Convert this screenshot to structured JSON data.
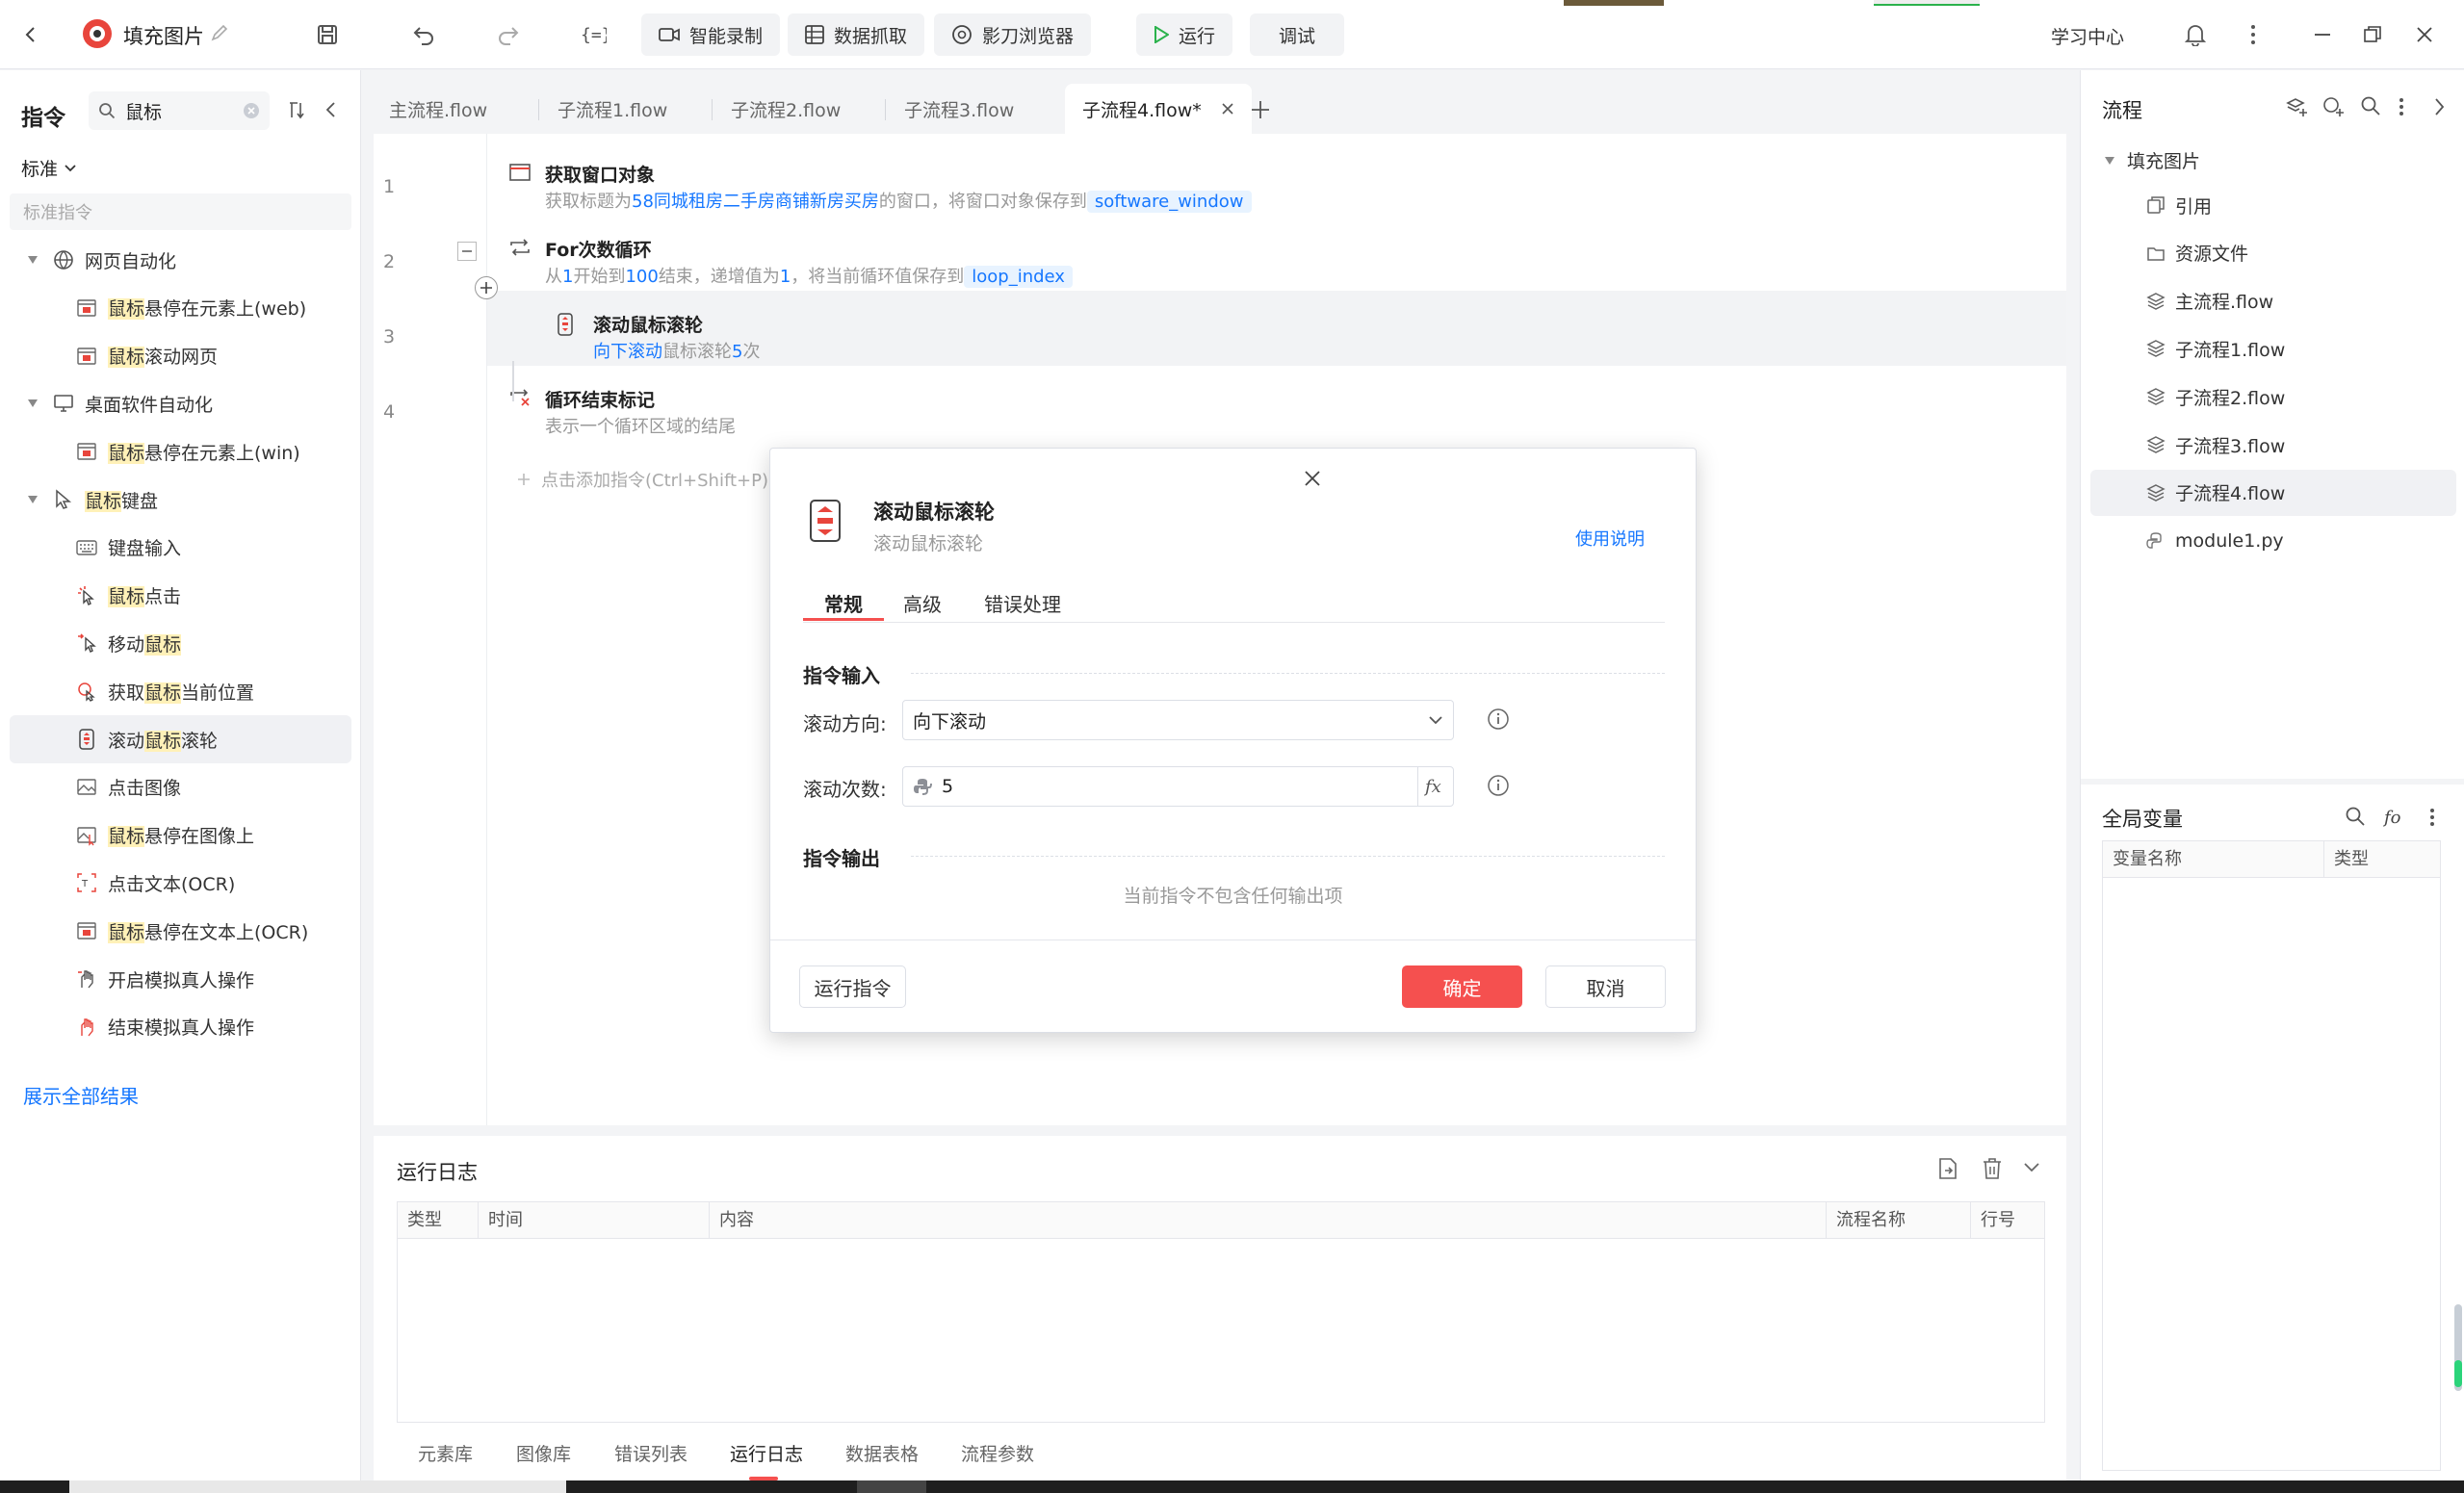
{
  "app": {
    "project_title": "填充图片",
    "toolbar": {
      "smart_record": "智能录制",
      "data_capture": "数据抓取",
      "browser": "影刀浏览器",
      "run": "运行",
      "debug": "调试",
      "learning_center": "学习中心"
    }
  },
  "left_panel": {
    "title": "指令",
    "search_value": "鼠标",
    "filter_label": "标准",
    "section_header": "标准指令",
    "tree": [
      {
        "type": "group",
        "label": "网页自动化",
        "icon": "globe-icon"
      },
      {
        "type": "item",
        "pre": "",
        "hl": "鼠标",
        "post": "悬停在元素上(web)",
        "icon": "web-hover-icon"
      },
      {
        "type": "item",
        "pre": "",
        "hl": "鼠标",
        "post": "滚动网页",
        "icon": "web-scroll-icon"
      },
      {
        "type": "group",
        "label": "桌面软件自动化",
        "icon": "monitor-icon"
      },
      {
        "type": "item",
        "pre": "",
        "hl": "鼠标",
        "post": "悬停在元素上(win)",
        "icon": "win-hover-icon"
      },
      {
        "type": "group",
        "pre": "",
        "hl": "鼠标",
        "post": "键盘",
        "icon": "cursor-icon"
      },
      {
        "type": "item",
        "pre": "键盘输入",
        "hl": "",
        "post": "",
        "icon": "keyboard-icon"
      },
      {
        "type": "item",
        "pre": "",
        "hl": "鼠标",
        "post": "点击",
        "icon": "mouse-click-icon"
      },
      {
        "type": "item",
        "pre": "移动",
        "hl": "鼠标",
        "post": "",
        "icon": "mouse-move-icon"
      },
      {
        "type": "item",
        "pre": "获取",
        "hl": "鼠标",
        "post": "当前位置",
        "icon": "mouse-position-icon"
      },
      {
        "type": "item",
        "pre": "滚动",
        "hl": "鼠标",
        "post": "滚轮",
        "icon": "mouse-wheel-icon",
        "selected": true
      },
      {
        "type": "item",
        "pre": "点击图像",
        "hl": "",
        "post": "",
        "icon": "image-click-icon"
      },
      {
        "type": "item",
        "pre": "",
        "hl": "鼠标",
        "post": "悬停在图像上",
        "icon": "image-hover-icon"
      },
      {
        "type": "item",
        "pre": "点击文本(OCR)",
        "hl": "",
        "post": "",
        "icon": "ocr-click-icon"
      },
      {
        "type": "item",
        "pre": "",
        "hl": "鼠标",
        "post": "悬停在文本上(OCR)",
        "icon": "ocr-hover-icon"
      },
      {
        "type": "item",
        "pre": "开启模拟真人操作",
        "hl": "",
        "post": "",
        "icon": "human-start-icon"
      },
      {
        "type": "item",
        "pre": "结束模拟真人操作",
        "hl": "",
        "post": "",
        "icon": "human-stop-icon"
      }
    ],
    "show_all": "展示全部结果"
  },
  "tabs": [
    {
      "label": "主流程.flow"
    },
    {
      "label": "子流程1.flow"
    },
    {
      "label": "子流程2.flow"
    },
    {
      "label": "子流程3.flow"
    },
    {
      "label": "子流程4.flow*",
      "active": true
    }
  ],
  "editor": {
    "steps": [
      {
        "num": "1",
        "title": "获取窗口对象",
        "desc": [
          "获取标题为",
          "58同城租房二手房商铺新房买房",
          "的窗口，将窗口对象保存到",
          "software_window"
        ]
      },
      {
        "num": "2",
        "title": "For次数循环",
        "desc": [
          "从",
          "1",
          "开始到",
          "100",
          "结束，递增值为",
          "1",
          "，将当前循环值保存到",
          "loop_index"
        ]
      },
      {
        "num": "3",
        "title": "滚动鼠标滚轮",
        "desc": [
          "向下滚动",
          "鼠标滚轮",
          "5",
          "次"
        ]
      },
      {
        "num": "4",
        "title": "循环结束标记",
        "desc": [
          "表示一个循环区域的结尾"
        ]
      }
    ],
    "add_hint": "点击添加指令(Ctrl+Shift+P)"
  },
  "log": {
    "title": "运行日志",
    "columns": [
      "类型",
      "时间",
      "内容",
      "流程名称",
      "行号"
    ],
    "bottom_tabs": [
      "元素库",
      "图像库",
      "错误列表",
      "运行日志",
      "数据表格",
      "流程参数"
    ],
    "active_bottom_tab": "运行日志"
  },
  "right_panel": {
    "title": "流程",
    "root": "填充图片",
    "items": [
      {
        "label": "引用",
        "icon": "reference-icon"
      },
      {
        "label": "资源文件",
        "icon": "resource-icon"
      },
      {
        "label": "主流程.flow",
        "icon": "layers-icon"
      },
      {
        "label": "子流程1.flow",
        "icon": "layers-icon"
      },
      {
        "label": "子流程2.flow",
        "icon": "layers-icon"
      },
      {
        "label": "子流程3.flow",
        "icon": "layers-icon"
      },
      {
        "label": "子流程4.flow",
        "icon": "layers-icon",
        "selected": true
      },
      {
        "label": "module1.py",
        "icon": "python-icon"
      }
    ],
    "globals_title": "全局变量",
    "globals_columns": [
      "变量名称",
      "类型"
    ]
  },
  "dialog": {
    "title": "滚动鼠标滚轮",
    "subtitle": "滚动鼠标滚轮",
    "help_link": "使用说明",
    "tabs": [
      "常规",
      "高级",
      "错误处理"
    ],
    "input_section": "指令输入",
    "direction_label": "滚动方向:",
    "direction_value": "向下滚动",
    "count_label": "滚动次数:",
    "count_value": "5",
    "output_section": "指令输出",
    "no_output": "当前指令不包含任何输出项",
    "run_button": "运行指令",
    "ok_button": "确定",
    "cancel_button": "取消"
  },
  "colors": {
    "accent": "#1677ff",
    "primary_red": "#f5504f",
    "highlight": "#fff1b8",
    "tab_underline": "#f5504f"
  }
}
